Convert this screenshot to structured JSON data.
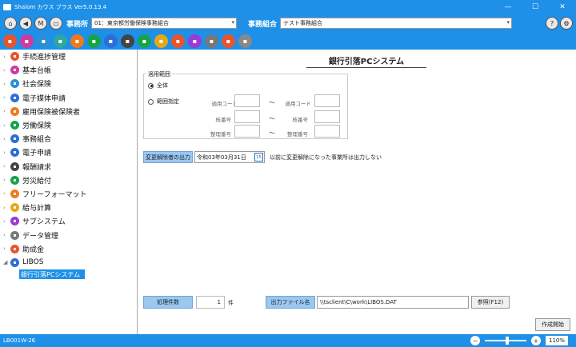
{
  "window": {
    "title": "Shalom カウス プラス Ver5.0.13.4",
    "minimize": "—",
    "maximize": "☐",
    "close": "✕"
  },
  "toolbar": {
    "office_label": "事務所",
    "office_value": "01：東京都労働保険事務組合",
    "union_label": "事務組合",
    "union_value": "テスト事務組合",
    "left_buttons": [
      "home-icon",
      "back-icon",
      "menu-icon",
      "keyboard-icon"
    ],
    "right_buttons": [
      "help-icon",
      "settings-icon"
    ],
    "icon_colors": [
      "#e8542b",
      "#d03aa0",
      "#2b8fd6",
      "#2ba8a0",
      "#ee7a1e",
      "#16a34a",
      "#2b6fd6",
      "#444444",
      "#16a34a",
      "#e6a817",
      "#e8542b",
      "#9b3ad6",
      "#777777",
      "#e8542b",
      "#888888"
    ]
  },
  "sidebar": {
    "items": [
      {
        "label": "手続進捗管理",
        "icon": "progress-icon",
        "color": "#e8542b"
      },
      {
        "label": "基本台帳",
        "icon": "ledger-icon",
        "color": "#d03aa0"
      },
      {
        "label": "社会保険",
        "icon": "social-insurance-icon",
        "color": "#2b8fd6"
      },
      {
        "label": "電子媒体申請",
        "icon": "electronic-icon",
        "color": "#2b6fd6"
      },
      {
        "label": "雇用保険被保険者",
        "icon": "employment-icon",
        "color": "#ee7a1e"
      },
      {
        "label": "労働保険",
        "icon": "labor-insurance-icon",
        "color": "#16a34a"
      },
      {
        "label": "事務組合",
        "icon": "union-icon",
        "color": "#2b6fd6"
      },
      {
        "label": "電子申請",
        "icon": "e-application-icon",
        "color": "#2b6fd6"
      },
      {
        "label": "報酬請求",
        "icon": "billing-icon",
        "color": "#444444"
      },
      {
        "label": "労災給付",
        "icon": "accident-icon",
        "color": "#16a34a"
      },
      {
        "label": "フリーフォーマット",
        "icon": "free-format-icon",
        "color": "#ee7a1e"
      },
      {
        "label": "給与計算",
        "icon": "payroll-icon",
        "color": "#e6a817"
      },
      {
        "label": "サブシステム",
        "icon": "subsystem-icon",
        "color": "#9b3ad6"
      },
      {
        "label": "データ管理",
        "icon": "data-icon",
        "color": "#777777"
      },
      {
        "label": "助成金",
        "icon": "subsidy-icon",
        "color": "#e8542b"
      },
      {
        "label": "LIBOS",
        "icon": "libos-icon",
        "color": "#2b6fd6"
      }
    ],
    "selected_child": "銀行引落PCシステム"
  },
  "main": {
    "title": "銀行引落PCシステム",
    "range": {
      "label": "適用範囲",
      "all": "全体",
      "specified": "範囲指定",
      "fields": [
        {
          "left": "適用コード",
          "right": "適用コード"
        },
        {
          "left": "枝番号",
          "right": "枝番号"
        },
        {
          "left": "整理番号",
          "right": "整理番号"
        }
      ],
      "tilde": "～"
    },
    "cancel_button": "変更解除者の出力",
    "date_value": "令和03年03月31日",
    "calendar_day": "15",
    "note": "以前に変更解除になった事業所は出力しない",
    "count_button": "処理件数",
    "count_value": "1",
    "count_unit": "件",
    "output_file_button": "出力ファイル名",
    "output_path": "\\\\tsclient\\C\\work\\LIBOS.DAT",
    "browse_button": "参照(F12)",
    "create_button": "作成開始"
  },
  "status": {
    "screen_id": "LB001W-26",
    "zoom": "110%",
    "zoom_fraction": 0.55
  }
}
